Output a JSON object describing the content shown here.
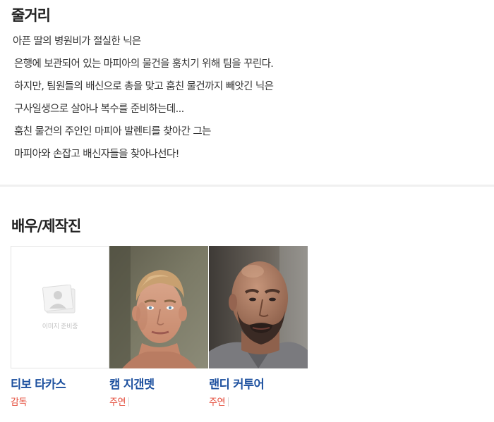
{
  "synopsis": {
    "title": "줄거리",
    "lines": [
      "아픈 딸의 병원비가 절실한 닉은",
      "은행에 보관되어 있는 마피아의 물건을 훔치기 위해 팀을 꾸린다.",
      "하지만, 팀원들의 배신으로 총을 맞고 훔친 물건까지 빼앗긴 닉은",
      "구사일생으로 살아나 복수를 준비하는데...",
      "훔친 물건의 주인인 마피아 발렌티를 찾아간 그는",
      "마피아와 손잡고 배신자들을 찾아나선다!"
    ]
  },
  "cast": {
    "title": "배우/제작진",
    "placeholder_text": "이미지 준비중",
    "members": [
      {
        "name": "티보 타카스",
        "role": "감독",
        "photo": "placeholder"
      },
      {
        "name": "캠 지갠뎃",
        "role": "주연",
        "photo": "portrait-young-man"
      },
      {
        "name": "랜디 커투어",
        "role": "주연",
        "photo": "portrait-bald-man"
      }
    ]
  },
  "colors": {
    "name_link": "#1b4f9e",
    "role_text": "#e44b3a",
    "divider": "#f0f0f0"
  }
}
